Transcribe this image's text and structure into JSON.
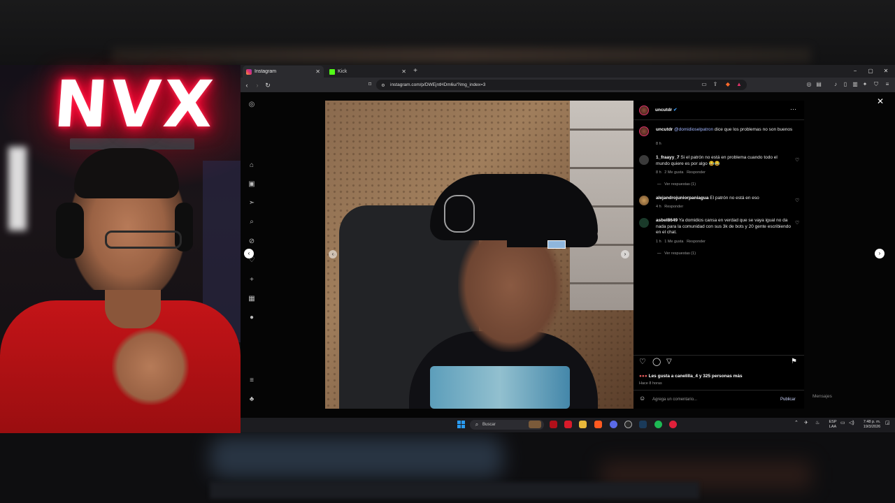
{
  "browser": {
    "tabs": [
      {
        "label": "Instagram",
        "active": true
      },
      {
        "label": "Kick",
        "active": false
      }
    ],
    "url": "instagram.com/p/DWEjntHDm6u/?img_index=3",
    "window_controls": [
      "−",
      "▢",
      "✕"
    ]
  },
  "stream": {
    "neon_sign": "NVX"
  },
  "post": {
    "author": "uncutdr",
    "verified": true,
    "caption": {
      "user": "uncutdr",
      "mention": "@domidioselpatron",
      "text": " dice que los problemas no son buenos",
      "time": "8 h"
    },
    "comments": [
      {
        "user": "1_fraayy_7",
        "text": " Si el patrón no está en problema cuando todo el mundo quiere es por algo 😂😂",
        "time": "8 h",
        "likes": "2 Me gusta",
        "reply": "Responder",
        "replies": "Ver respuestas (1)"
      },
      {
        "user": "alejandrojuniorpaniagua",
        "text": " El patrón no está en eso",
        "time": "4 h",
        "reply": "Responder"
      },
      {
        "user": "asbel8649",
        "text": " Ya domidios cansa en verdad que se vaya igual no da nada para la comunidad con sus 3k de bots y 20 gente escribiendo en el chat.",
        "time": "1 h",
        "likes": "1 Me gusta",
        "reply": "Responder",
        "replies": "Ver respuestas (1)"
      }
    ],
    "likes_text": "Les gusta a canelilla_4 y 325 personas más",
    "posted": "Hace 8 horas",
    "comment_placeholder": "Agrega un comentario...",
    "publish": "Publicar",
    "messages": "Mensajes"
  },
  "taskbar": {
    "search": "Buscar",
    "lang_top": "ESP",
    "lang_bottom": "LAA",
    "time": "7:48 p. m.",
    "date": "19/3/2026"
  },
  "colors": {
    "neon": "#ff1040",
    "ig_bg": "#000000",
    "mention": "#a2b6ff",
    "win_accent": "#2a9bf0"
  }
}
